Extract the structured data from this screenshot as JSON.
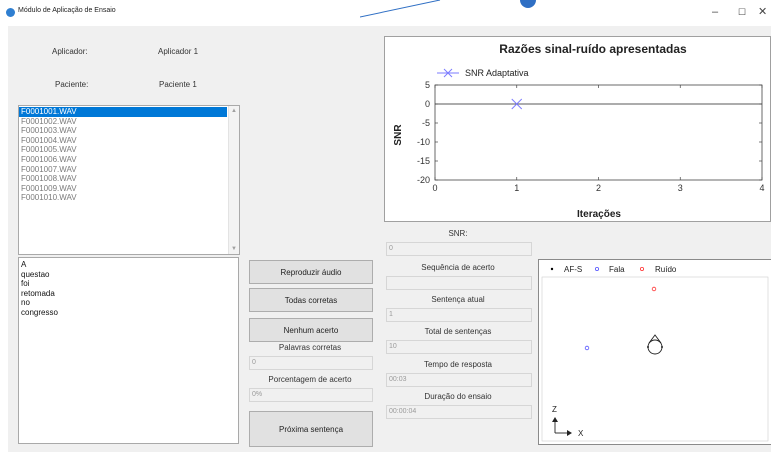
{
  "window": {
    "title": "Módulo de Aplicação de Ensaio",
    "minimize_glyph": "–",
    "maximize_glyph": "☐",
    "close_glyph": "✕"
  },
  "form": {
    "applicator_label": "Aplicador:",
    "applicator_value": "Aplicador 1",
    "patient_label": "Paciente:",
    "patient_value": "Paciente 1"
  },
  "file_list": {
    "selected_index": 0,
    "items": [
      "F0001001.WAV",
      "F0001002.WAV",
      "F0001003.WAV",
      "F0001004.WAV",
      "F0001005.WAV",
      "F0001006.WAV",
      "F0001007.WAV",
      "F0001008.WAV",
      "F0001009.WAV",
      "F0001010.WAV"
    ]
  },
  "sentence_words": [
    "A",
    "questao",
    "foi",
    "retomada",
    "no",
    "congresso"
  ],
  "buttons": {
    "play_audio": "Reproduzir áudio",
    "all_correct": "Todas corretas",
    "no_correct": "Nenhum acerto",
    "next_sentence": "Próxima sentença"
  },
  "fields": {
    "correct_words_label": "Palavras corretas",
    "correct_words_value": "0",
    "accuracy_label": "Porcentagem de acerto",
    "accuracy_value": "0%",
    "snr_label": "SNR:",
    "snr_value": "0",
    "sequence_label": "Sequência de acerto",
    "sequence_value": "",
    "current_sentence_label": "Sentença atual",
    "current_sentence_value": "1",
    "total_sentences_label": "Total de sentenças",
    "total_sentences_value": "10",
    "response_time_label": "Tempo de resposta",
    "response_time_value": "00:03",
    "duration_label": "Duração do ensaio",
    "duration_value": "00:00:04"
  },
  "chart_data": {
    "type": "line",
    "title": "Razões sinal-ruído apresentadas",
    "xlabel": "Iterações",
    "ylabel": "SNR",
    "xlim": [
      0,
      4
    ],
    "ylim": [
      -20,
      5
    ],
    "xticks": [
      0,
      1,
      2,
      3,
      4
    ],
    "yticks": [
      5,
      0,
      -5,
      -10,
      -15,
      -20
    ],
    "legend_position": "top-left",
    "series": [
      {
        "name": "SNR Adaptativa",
        "color": "#7b7bff",
        "marker": "x",
        "x": [
          1
        ],
        "y": [
          0
        ]
      }
    ],
    "reference_line_y": 0
  },
  "scene": {
    "legend": [
      {
        "label": "AF-S",
        "marker": "dot",
        "color": "#000000"
      },
      {
        "label": "Fala",
        "marker": "circle",
        "color": "#5555ff"
      },
      {
        "label": "Ruído",
        "marker": "circle",
        "color": "#ff3333"
      }
    ],
    "axis_z": "Z",
    "axis_x": "X",
    "listener_icon": "head-icon"
  },
  "colors": {
    "selection": "#0078d7",
    "client_bg": "#f0f0f0",
    "series": "#7b7bff"
  }
}
